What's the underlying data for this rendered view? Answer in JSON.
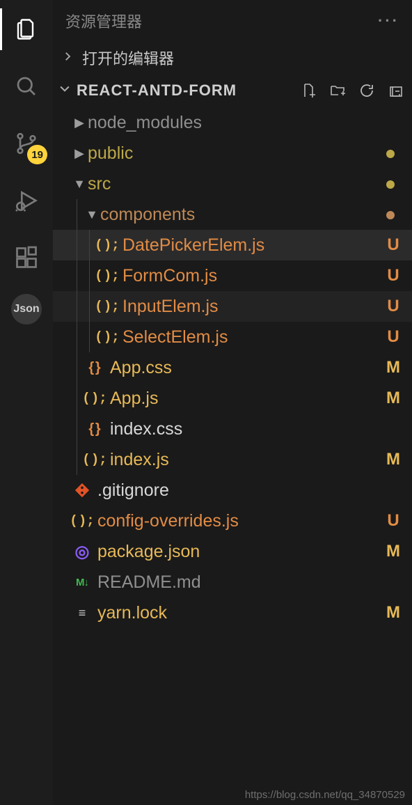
{
  "activityBar": {
    "items": [
      {
        "id": "explorer",
        "icon": "files",
        "active": true
      },
      {
        "id": "search",
        "icon": "search"
      },
      {
        "id": "scm",
        "icon": "branch",
        "badge": "19"
      },
      {
        "id": "run",
        "icon": "run"
      },
      {
        "id": "extensions",
        "icon": "extensions"
      },
      {
        "id": "json-ext",
        "icon": "json",
        "label": "Json"
      }
    ]
  },
  "sidebar": {
    "title": "资源管理器",
    "sections": {
      "openEditors": {
        "label": "打开的编辑器",
        "expanded": false
      },
      "project": {
        "name": "REACT-ANTD-FORM",
        "expanded": true,
        "actions": [
          "new-file",
          "new-folder",
          "refresh",
          "collapse-all"
        ]
      }
    }
  },
  "tree": [
    {
      "type": "folder",
      "name": "node_modules",
      "depth": 0,
      "expanded": false,
      "color": "gray"
    },
    {
      "type": "folder",
      "name": "public",
      "depth": 0,
      "expanded": false,
      "color": "olive",
      "dot": "#bda848"
    },
    {
      "type": "folder",
      "name": "src",
      "depth": 0,
      "expanded": true,
      "color": "olive",
      "dot": "#bda848"
    },
    {
      "type": "folder",
      "name": "components",
      "depth": 1,
      "expanded": true,
      "color": "sienna",
      "dot": "#bf8957"
    },
    {
      "type": "file",
      "name": "DatePickerElem.js",
      "depth": 2,
      "icon": "js",
      "status": "U",
      "statusColor": "untracked",
      "selected": true
    },
    {
      "type": "file",
      "name": "FormCom.js",
      "depth": 2,
      "icon": "js",
      "status": "U",
      "statusColor": "untracked"
    },
    {
      "type": "file",
      "name": "InputElem.js",
      "depth": 2,
      "icon": "js",
      "status": "U",
      "statusColor": "untracked",
      "hover": true
    },
    {
      "type": "file",
      "name": "SelectElem.js",
      "depth": 2,
      "icon": "js",
      "status": "U",
      "statusColor": "untracked"
    },
    {
      "type": "file",
      "name": "App.css",
      "depth": 1,
      "icon": "css",
      "status": "M",
      "statusColor": "modified"
    },
    {
      "type": "file",
      "name": "App.js",
      "depth": 1,
      "icon": "js",
      "status": "M",
      "statusColor": "modified"
    },
    {
      "type": "file",
      "name": "index.css",
      "depth": 1,
      "icon": "css",
      "color": "white"
    },
    {
      "type": "file",
      "name": "index.js",
      "depth": 1,
      "icon": "js",
      "status": "M",
      "statusColor": "modified"
    },
    {
      "type": "file",
      "name": ".gitignore",
      "depth": 0,
      "icon": "git",
      "color": "white"
    },
    {
      "type": "file",
      "name": "config-overrides.js",
      "depth": 0,
      "icon": "js",
      "status": "U",
      "statusColor": "untracked"
    },
    {
      "type": "file",
      "name": "package.json",
      "depth": 0,
      "icon": "json",
      "status": "M",
      "statusColor": "modified"
    },
    {
      "type": "file",
      "name": "README.md",
      "depth": 0,
      "icon": "md",
      "color": "gray"
    },
    {
      "type": "file",
      "name": "yarn.lock",
      "depth": 0,
      "icon": "lock",
      "status": "M",
      "statusColor": "modified"
    }
  ],
  "watermark": "https://blog.csdn.net/qq_34870529"
}
